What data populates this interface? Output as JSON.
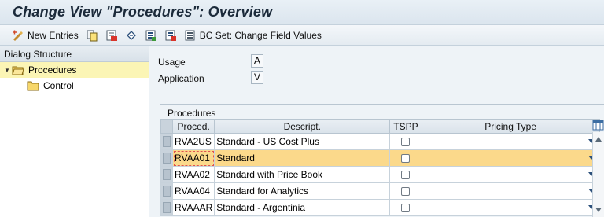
{
  "window": {
    "title": "Change View \"Procedures\": Overview"
  },
  "toolbar": {
    "items": [
      {
        "icon": "new-entries-icon",
        "label": "New Entries"
      },
      {
        "icon": "copy-icon",
        "label": ""
      },
      {
        "icon": "delete-icon",
        "label": ""
      },
      {
        "icon": "undo-change-icon",
        "label": ""
      },
      {
        "icon": "select-all-icon",
        "label": ""
      },
      {
        "icon": "select-block-icon",
        "label": ""
      },
      {
        "icon": "bc-set-icon",
        "label": "BC Set: Change Field Values"
      }
    ]
  },
  "dialog_structure": {
    "header": "Dialog Structure",
    "items": [
      {
        "label": "Procedures",
        "icon": "folder-open-icon",
        "selected": true,
        "expanded": true
      },
      {
        "label": "Control",
        "icon": "folder-icon",
        "selected": false
      }
    ]
  },
  "fields": {
    "usage": {
      "label": "Usage",
      "value": "A"
    },
    "application": {
      "label": "Application",
      "value": "V"
    }
  },
  "procedures": {
    "title": "Procedures",
    "columns": [
      "Proced.",
      "Descript.",
      "TSPP",
      "Pricing Type"
    ],
    "rows": [
      {
        "code": "RVA2US",
        "description": "Standard - US Cost Plus",
        "tspp": false,
        "pricing_type": "",
        "selected": false
      },
      {
        "code": "RVAA01",
        "description": "Standard",
        "tspp": false,
        "pricing_type": "",
        "selected": true
      },
      {
        "code": "RVAA02",
        "description": "Standard with Price Book",
        "tspp": false,
        "pricing_type": "",
        "selected": false
      },
      {
        "code": "RVAA04",
        "description": "Standard for Analytics",
        "tspp": false,
        "pricing_type": "",
        "selected": false
      },
      {
        "code": "RVAAAR",
        "description": "Standard - Argentinia",
        "tspp": false,
        "pricing_type": "",
        "selected": false
      }
    ]
  },
  "colors": {
    "selected_row": "#fbd98b",
    "tree_selected": "#fbf5b5",
    "accent": "#2b4f7a"
  }
}
